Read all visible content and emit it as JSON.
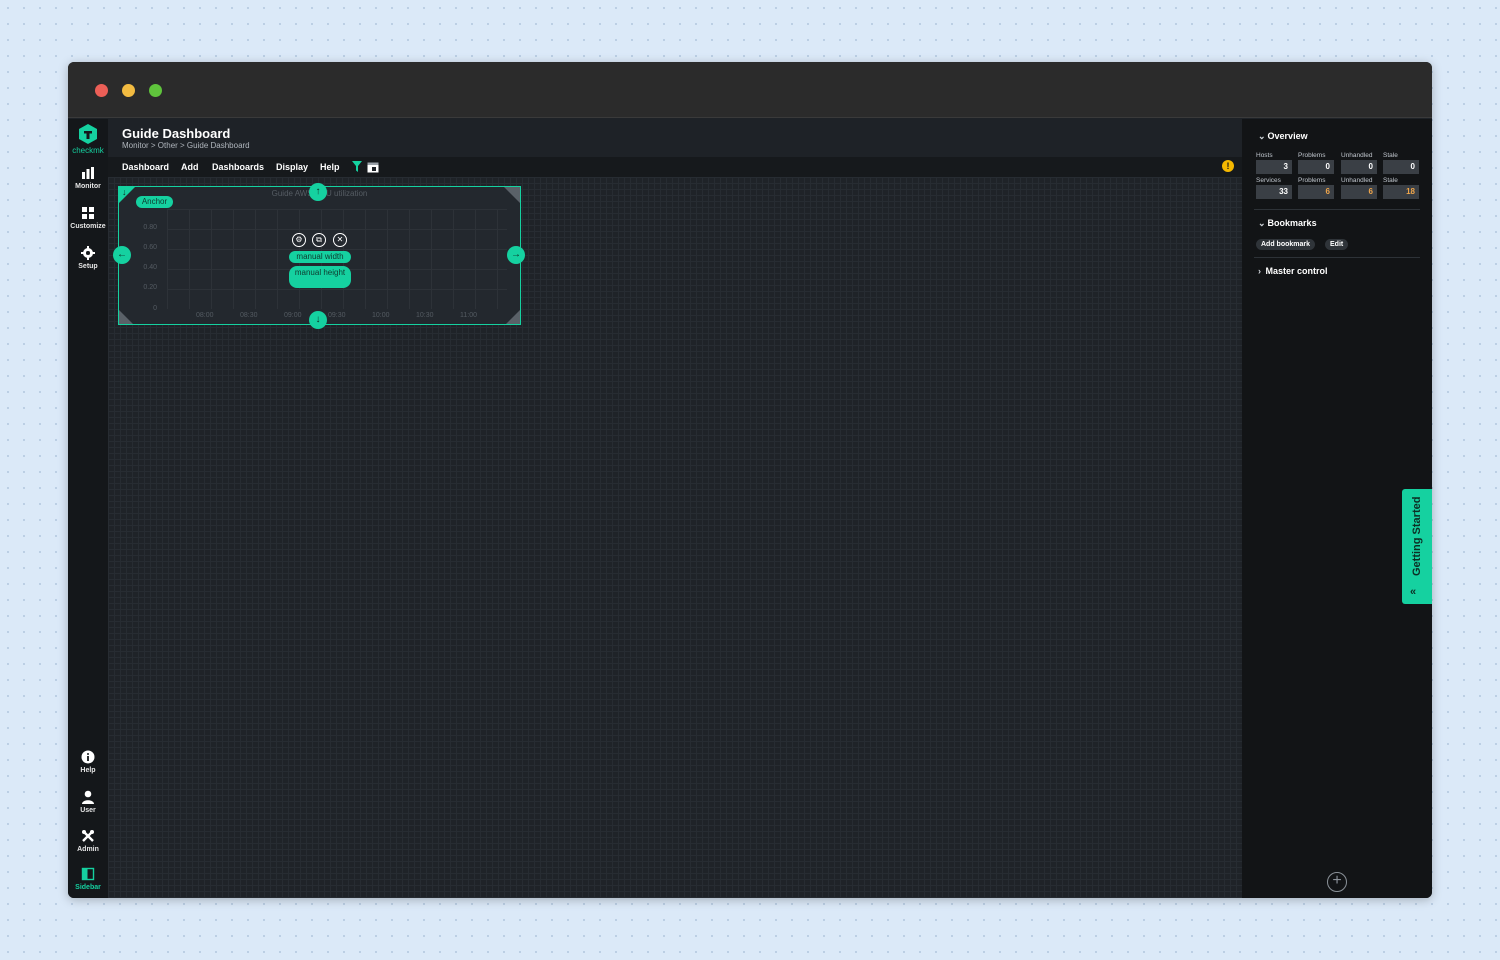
{
  "app": {
    "logo_text": "checkmk",
    "accent_color": "#15d1a0"
  },
  "nav": {
    "monitor": "Monitor",
    "customize": "Customize",
    "setup": "Setup",
    "help": "Help",
    "user": "User",
    "admin": "Admin",
    "sidebar": "Sidebar"
  },
  "page": {
    "title": "Guide Dashboard",
    "breadcrumb": "Monitor > Other > Guide Dashboard"
  },
  "menu": {
    "dashboard": "Dashboard",
    "add": "Add",
    "dashboards": "Dashboards",
    "display": "Display",
    "help": "Help"
  },
  "dashlet": {
    "title": "Guide AWS CPU utilization",
    "anchor_label": "Anchor",
    "manual_width": "manual width",
    "manual_height": "manual height",
    "y_ticks": [
      "0.80",
      "0.60",
      "0.40",
      "0.20",
      "0"
    ],
    "x_ticks": [
      "08:00",
      "08:30",
      "09:00",
      "09:30",
      "10:00",
      "10:30",
      "11:00"
    ]
  },
  "sidebar": {
    "overview": {
      "title": "Overview",
      "hosts_label": "Hosts",
      "services_label": "Services",
      "problems_label": "Problems",
      "unhandled_label": "Unhandled",
      "stale_label": "Stale",
      "hosts": {
        "total": "3",
        "problems": "0",
        "unhandled": "0",
        "stale": "0"
      },
      "services": {
        "total": "33",
        "problems": "6",
        "unhandled": "6",
        "stale": "18"
      }
    },
    "bookmarks": {
      "title": "Bookmarks",
      "add_label": "Add bookmark",
      "edit_label": "Edit"
    },
    "master_control": {
      "title": "Master control"
    },
    "getting_started": "Getting Started"
  }
}
